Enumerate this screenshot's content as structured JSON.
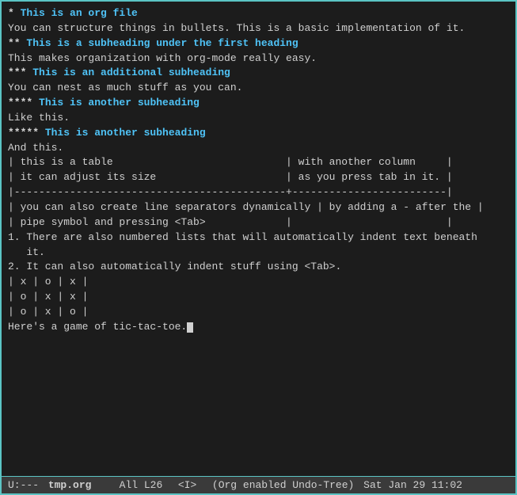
{
  "editor": {
    "lines": [
      {
        "id": "l1",
        "type": "heading1",
        "stars": "* ",
        "title": "This is an org file"
      },
      {
        "id": "l2",
        "type": "normal",
        "text": "You can structure things in bullets. This is a basic implementation of it."
      },
      {
        "id": "l3",
        "type": "heading2",
        "stars": "** ",
        "title": "This is a subheading under the first heading"
      },
      {
        "id": "l4",
        "type": "normal",
        "text": "This makes organization with org-mode really easy."
      },
      {
        "id": "l5",
        "type": "heading3",
        "stars": "*** ",
        "title": "This is an additional subheading"
      },
      {
        "id": "l6",
        "type": "normal",
        "text": "You can nest as much stuff as you can."
      },
      {
        "id": "l7",
        "type": "heading4",
        "stars": "**** ",
        "title": "This is another subheading"
      },
      {
        "id": "l8",
        "type": "normal",
        "text": "Like this."
      },
      {
        "id": "l9",
        "type": "heading5",
        "stars": "***** ",
        "title": "This is another subheading"
      },
      {
        "id": "l10",
        "type": "normal",
        "text": "And this."
      },
      {
        "id": "l11",
        "type": "blank",
        "text": ""
      },
      {
        "id": "l12",
        "type": "table",
        "text": "| this is a table                            | with another column     |"
      },
      {
        "id": "l13",
        "type": "table",
        "text": "| it can adjust its size                     | as you press tab in it. |"
      },
      {
        "id": "l14",
        "type": "table",
        "text": "|--------------------------------------------+-------------------------|"
      },
      {
        "id": "l15",
        "type": "table",
        "text": "| you can also create line separators dynamically | by adding a - after the |"
      },
      {
        "id": "l16",
        "type": "table",
        "text": "| pipe symbol and pressing <Tab>             |                         |"
      },
      {
        "id": "l17",
        "type": "blank",
        "text": ""
      },
      {
        "id": "l18",
        "type": "numbered",
        "text": "1. There are also numbered lists that will automatically indent text beneath"
      },
      {
        "id": "l19",
        "type": "numbered",
        "text": "   it."
      },
      {
        "id": "l20",
        "type": "numbered",
        "text": "2. It can also automatically indent stuff using <Tab>."
      },
      {
        "id": "l21",
        "type": "blank",
        "text": ""
      },
      {
        "id": "l22",
        "type": "table",
        "text": "| x | o | x |"
      },
      {
        "id": "l23",
        "type": "table",
        "text": "| o | x | x |"
      },
      {
        "id": "l24",
        "type": "table",
        "text": "| o | x | o |"
      },
      {
        "id": "l25",
        "type": "blank",
        "text": ""
      },
      {
        "id": "l26",
        "type": "cursor-line",
        "text": "Here's a game of tic-tac-toe."
      }
    ]
  },
  "statusbar": {
    "mode": "U:---",
    "filename": "tmp.org",
    "position": "All L26",
    "state": "<I>",
    "extra": "(Org enabled Undo-Tree)",
    "time": "Sat Jan 29 11:02"
  }
}
